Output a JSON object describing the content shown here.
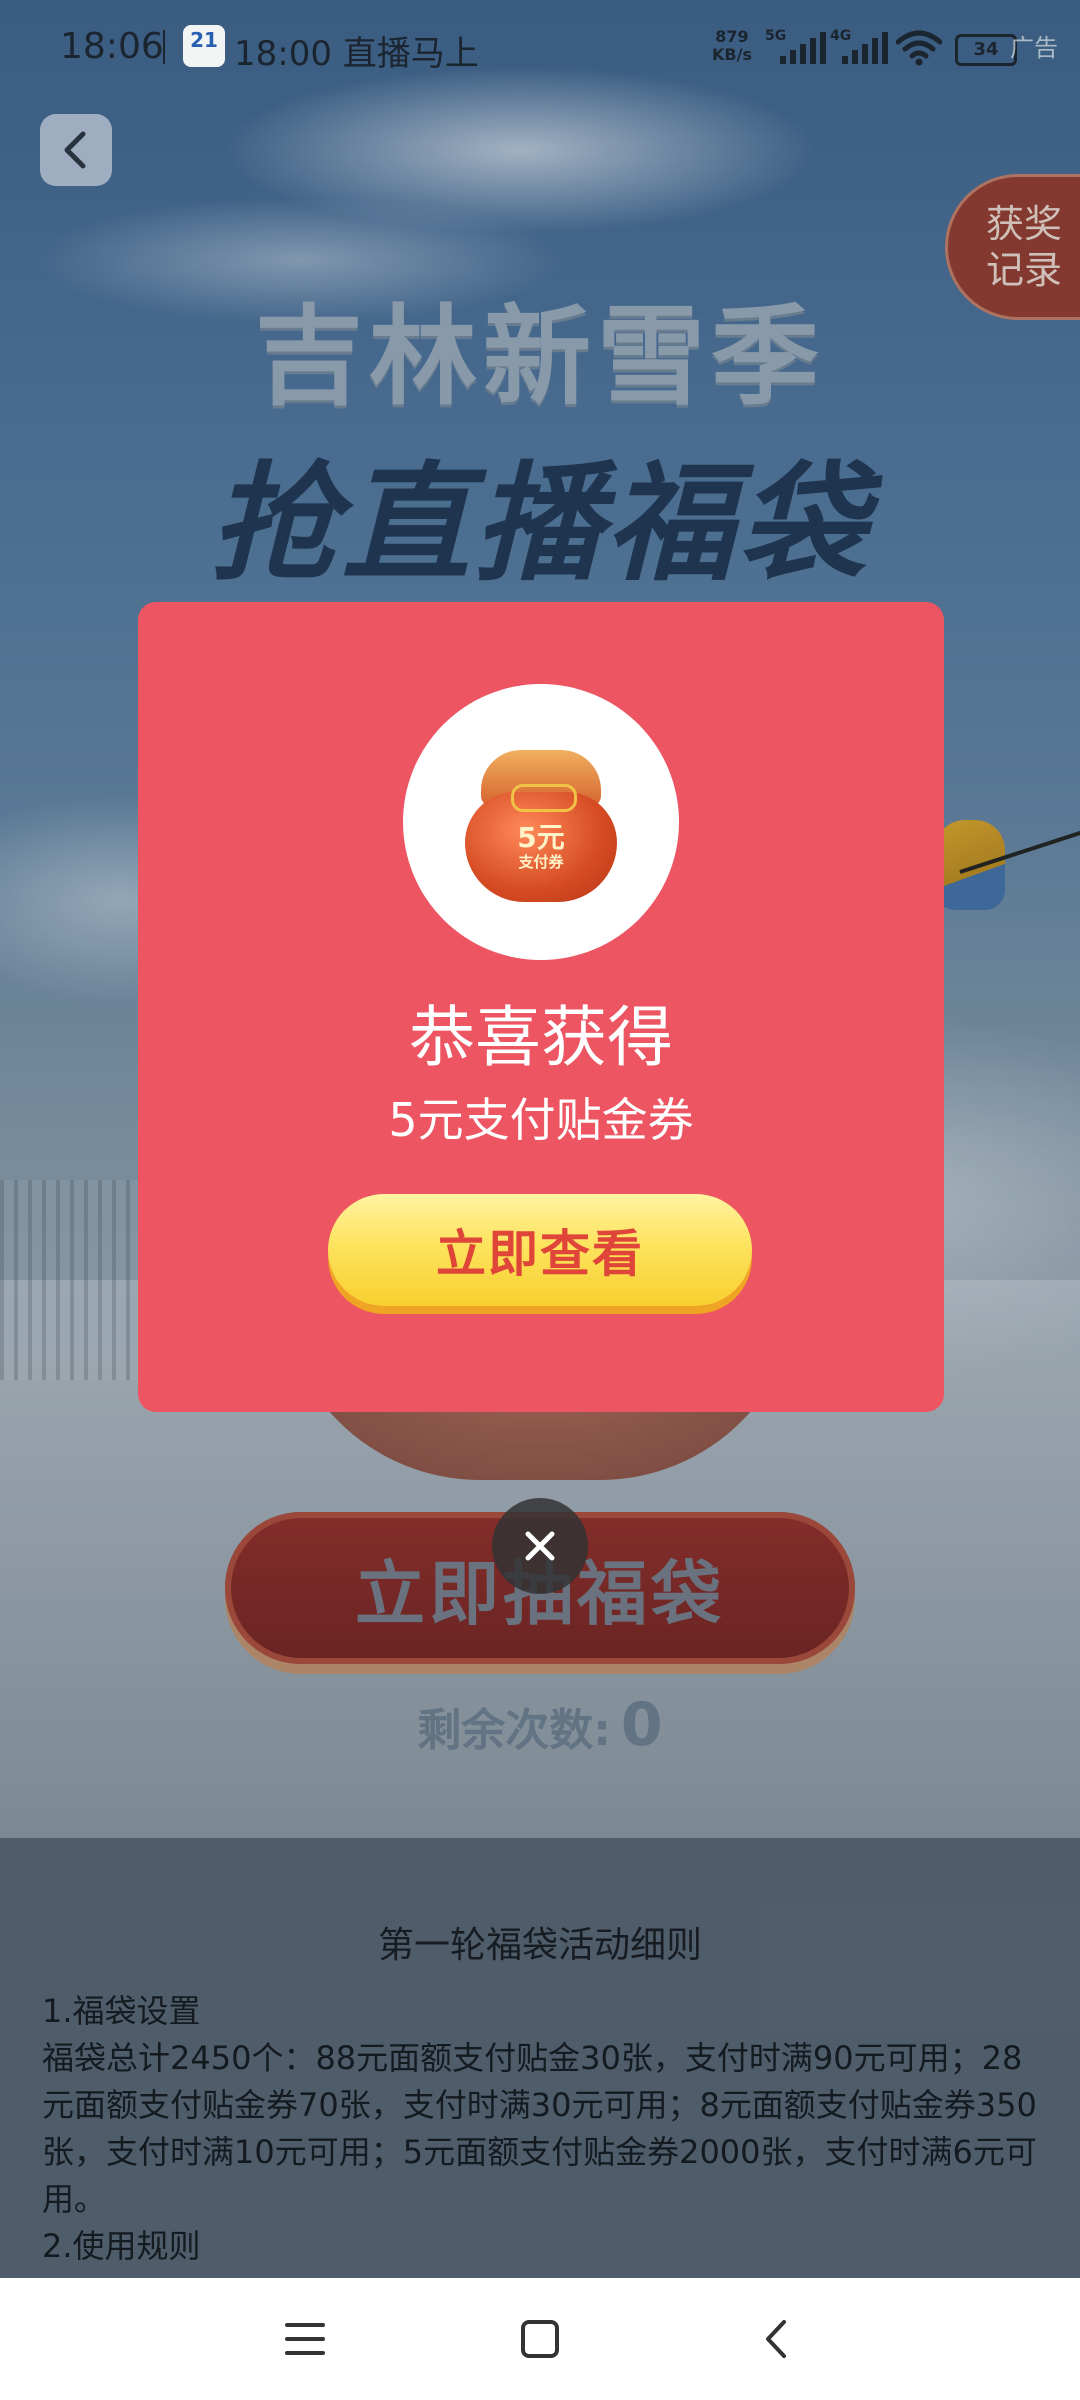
{
  "status_bar": {
    "time": "18:06",
    "notification_app_icon_text": "21",
    "notification_text": "18:00 直播马上",
    "net_speed_value": "879",
    "net_speed_unit": "KB/s",
    "net_5g": "5G",
    "net_4g": "4G",
    "battery": "34",
    "ad_label": "广告"
  },
  "hero": {
    "title_line1": "吉林新雪季",
    "title_line2": "抢直播福袋"
  },
  "side_tab": {
    "label_line1": "获奖",
    "label_line2": "记录"
  },
  "modal": {
    "bag_amount": "5元",
    "bag_sub": "支付券",
    "congrats": "恭喜获得",
    "prize_name": "5元支付贴金券",
    "view_button": "立即查看"
  },
  "draw": {
    "button_label": "立即抽福袋",
    "remaining_label": "剩余次数:",
    "remaining_count": "0"
  },
  "rules": {
    "title": "第一轮福袋活动细则",
    "lines": [
      "1.福袋设置",
      "福袋总计2450个：88元面额支付贴金30张，支付时满90元可用；28元面额支付贴金券70张，支付时满30元可用；8元面额支付贴金券350张，支付时满10元可用；5元面额支付贴金券2000张，支付时满6元可用。",
      "2.使用规则"
    ]
  },
  "colors": {
    "modal_bg": "#ec5561",
    "button_yellow": "#fde35e",
    "button_text_red": "#e0453a"
  },
  "icons": [
    "back-chevron-icon",
    "close-icon",
    "wifi-icon",
    "signal-icon",
    "battery-icon",
    "menu-icon",
    "home-icon",
    "back-icon"
  ]
}
